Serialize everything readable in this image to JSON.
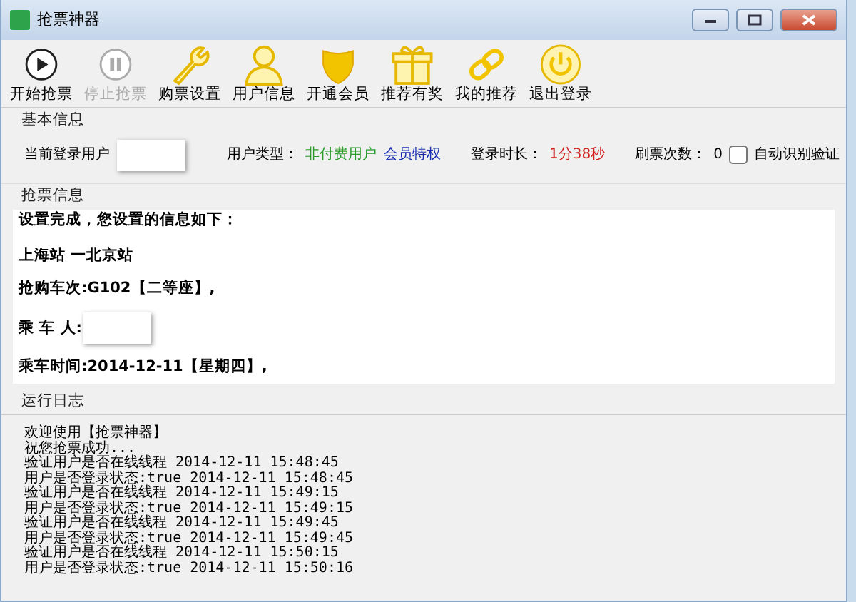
{
  "window": {
    "title": "抢票神器"
  },
  "toolbar": [
    {
      "label": "开始抢票",
      "kind": "play",
      "disabled": false
    },
    {
      "label": "停止抢票",
      "kind": "pause",
      "disabled": true
    },
    {
      "label": "购票设置",
      "kind": "wrench",
      "disabled": false
    },
    {
      "label": "用户信息",
      "kind": "user",
      "disabled": false
    },
    {
      "label": "开通会员",
      "kind": "shield",
      "disabled": false
    },
    {
      "label": "推荐有奖",
      "kind": "gift",
      "disabled": false
    },
    {
      "label": "我的推荐",
      "kind": "link",
      "disabled": false
    },
    {
      "label": "退出登录",
      "kind": "power",
      "disabled": false
    }
  ],
  "basic_info": {
    "title": "基本信息",
    "user_label": "当前登录用户",
    "user_type_label": "用户类型：",
    "user_type": "非付费用户",
    "member_link": "会员特权",
    "duration_label": "登录时长：",
    "duration": "1分38秒",
    "refresh_label": "刷票次数：",
    "refresh_count": "0",
    "auto_captcha": {
      "label": "自动识别验证",
      "checked": false
    }
  },
  "ticket_info": {
    "title": "抢票信息",
    "lines": [
      {
        "kind": "text",
        "text": "设置完成，您设置的信息如下："
      },
      {
        "kind": "text",
        "text": "上海站 一北京站"
      },
      {
        "kind": "text",
        "text": "**抢购车次:**G102**【二等座】**,"
      },
      {
        "kind": "blurred",
        "text": "乘 车 人:"
      },
      {
        "kind": "text",
        "text": "**乘车时间:**2014-12-11**【星期四】**,"
      }
    ]
  },
  "log": {
    "title": "运行日志",
    "lines": [
      "欢迎使用【抢票神器】",
      "祝您抢票成功...",
      "验证用户是否在线线程 2014-12-11 15:48:45",
      "用户是否登录状态:true 2014-12-11 15:48:45",
      "验证用户是否在线线程 2014-12-11 15:49:15",
      "用户是否登录状态:true 2014-12-11 15:49:15",
      "验证用户是否在线线程 2014-12-11 15:49:45",
      "用户是否登录状态:true 2014-12-11 15:49:45",
      "验证用户是否在线线程 2014-12-11 15:50:15",
      "用户是否登录状态:true 2014-12-11 15:50:16"
    ]
  }
}
